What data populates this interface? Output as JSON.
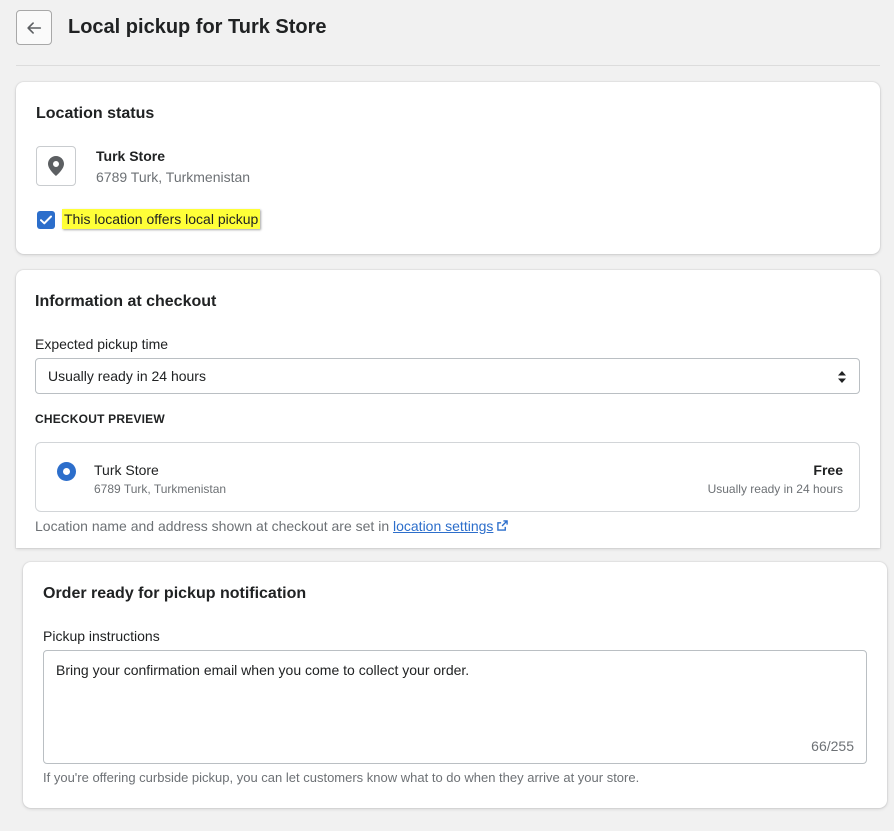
{
  "header": {
    "title": "Local pickup for Turk Store"
  },
  "location_status": {
    "title": "Location status",
    "location_name": "Turk Store",
    "location_address": "6789 Turk, Turkmenistan",
    "checkbox_label": "This location offers local pickup",
    "checkbox_checked": true
  },
  "checkout_info": {
    "title": "Information at checkout",
    "pickup_time_label": "Expected pickup time",
    "pickup_time_value": "Usually ready in 24 hours",
    "preview_heading": "CHECKOUT PREVIEW",
    "preview": {
      "name": "Turk Store",
      "address": "6789 Turk, Turkmenistan",
      "price": "Free",
      "ready_text": "Usually ready in 24 hours"
    },
    "help_text": "Location name and address shown at checkout are set in",
    "help_link": "location settings"
  },
  "notification": {
    "title": "Order ready for pickup notification",
    "instructions_label": "Pickup instructions",
    "instructions_value": "Bring your confirmation email when you come to collect your order.",
    "char_count": "66/255",
    "help_text": "If you're offering curbside pickup, you can let customers know what to do when they arrive at your store."
  },
  "colors": {
    "accent": "#2c6ecb",
    "highlight": "#ffff38",
    "background": "#f1f1f1"
  },
  "icons": {
    "back": "arrow-left-icon",
    "location": "location-pin-icon",
    "check": "checkmark-icon",
    "select": "select-arrows-icon",
    "external": "external-link-icon"
  }
}
